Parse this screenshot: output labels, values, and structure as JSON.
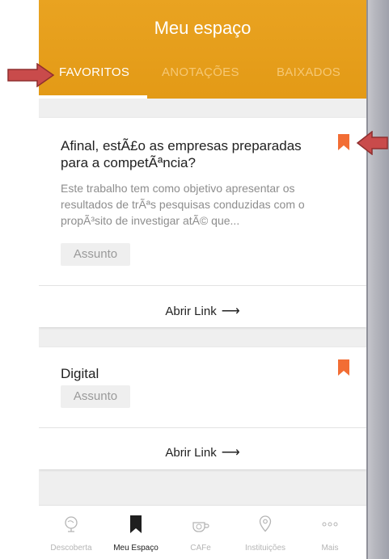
{
  "header": {
    "title": "Meu espaço",
    "tabs": [
      {
        "label": "FAVORITOS",
        "active": true
      },
      {
        "label": "ANOTAÇÕES",
        "active": false
      },
      {
        "label": "BAIXADOS",
        "active": false
      }
    ]
  },
  "cards": [
    {
      "title": "Afinal, estÃ£o as empresas preparadas para a competÃªncia?",
      "description": "Este trabalho tem como objetivo apresentar os resultados de trÃªs pesquisas conduzidas com o propÃ³sito de investigar atÃ© que...",
      "tag": "Assunto",
      "link_label": "Abrir Link",
      "bookmarked": true
    },
    {
      "title": "Digital",
      "tag": "Assunto",
      "link_label": "Abrir Link",
      "bookmarked": true
    }
  ],
  "bottom_nav": [
    {
      "label": "Descoberta",
      "icon": "globe-icon",
      "active": false
    },
    {
      "label": "Meu Espaço",
      "icon": "bookmark-icon",
      "active": true
    },
    {
      "label": "CAFe",
      "icon": "cafe-icon",
      "active": false
    },
    {
      "label": "Instituições",
      "icon": "location-pin-icon",
      "active": false
    },
    {
      "label": "Mais",
      "icon": "more-dots-icon",
      "active": false
    }
  ],
  "colors": {
    "header": "#e69f1d",
    "bookmark": "#f26d34",
    "annotation_arrow": "#c94b4b"
  }
}
